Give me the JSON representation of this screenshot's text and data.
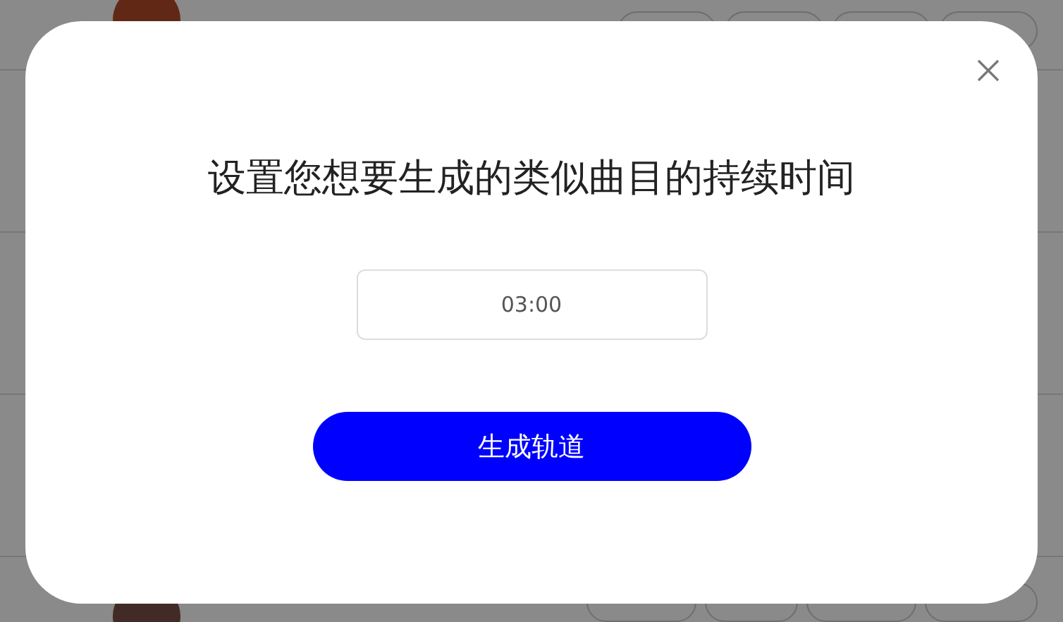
{
  "dialog": {
    "title": "设置您想要生成的类似曲目的持续时间",
    "duration_field": {
      "value": "03:00"
    },
    "generate_button": "生成轨道"
  }
}
